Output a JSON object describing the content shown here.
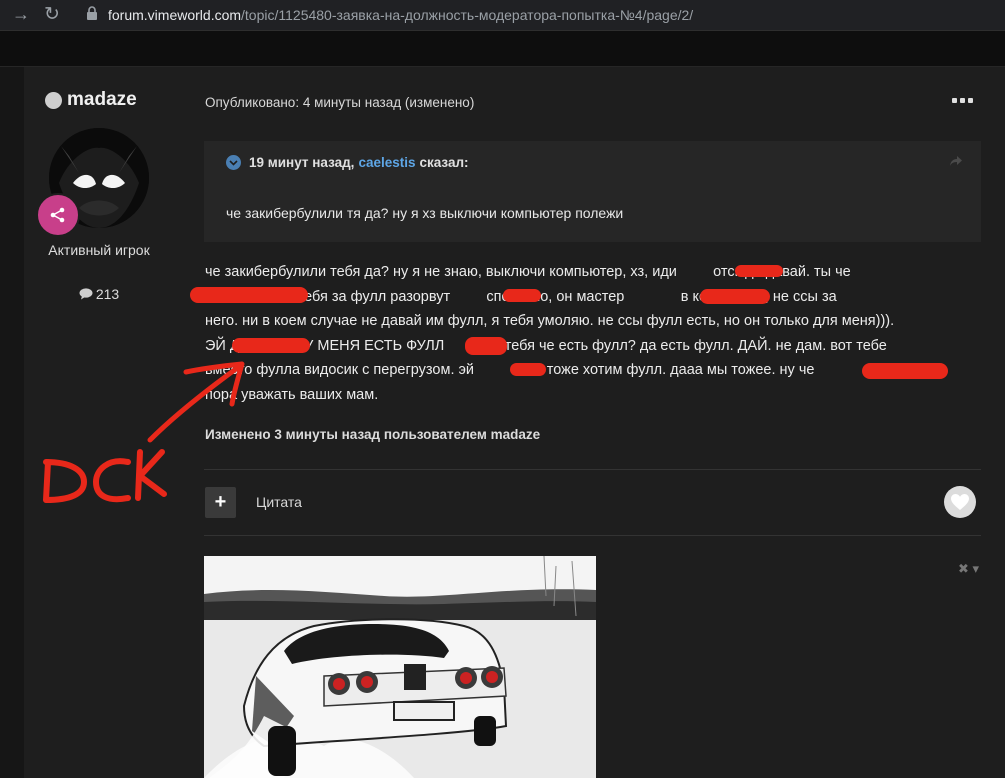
{
  "browser": {
    "url_host": "forum.vimeworld.com",
    "url_path": "/topic/1125480-заявка-на-должность-модератора-попытка-№4/page/2/"
  },
  "author": {
    "name": "madaze",
    "rank": "Активный игрок",
    "post_count": "213"
  },
  "post": {
    "published": "Опубликовано: 4 минуты назад (изменено)",
    "quote": {
      "time": "19 минут назад,",
      "author": "caelestis",
      "said": "сказал:",
      "text": "че закибербулили тя да? ну я хз выключи компьютер полежи"
    },
    "body_lines": [
      "че закибербулили тебя да? ну я не знаю, выключи компьютер, хз, иди         отсюда давай. ты че",
      "                  ни тебя за фулл разорвут         спокойно, он мастер              в комментах, не ссы за",
      "него. ни в коем случае не давай им фулл, я тебя умоляю. не ссы фулл есть, но он только для меня))).",
      "ЭЙ Д                У МЕНЯ ЕСТЬ ФУЛЛ               тебя че есть фулл? да есть фулл. ДАЙ. не дам. вот тебе",
      "вместо фулла видосик с перегрузом. эй            мы тоже хотим фулл. дааа мы тожее. ну че",
      "пора уважать ваших мам."
    ],
    "edited_note": "Изменено 3 минуты назад пользователем madaze",
    "quote_button_label": "Цитата"
  },
  "annotation": {
    "handwritten_text": "DCK",
    "color": "#e8281a"
  },
  "icons": {
    "back": "arrow-right-icon",
    "reload": "reload-icon",
    "lock": "lock-icon",
    "more": "more-options-icon",
    "share": "share-icon",
    "like": "heart-icon",
    "comments": "speech-bubble-icon"
  },
  "colors": {
    "page_bg": "#161616",
    "post_bg": "#1e1e1e",
    "quote_bg": "#262626",
    "link": "#5ea6e6",
    "badge": "#c83f8a"
  }
}
